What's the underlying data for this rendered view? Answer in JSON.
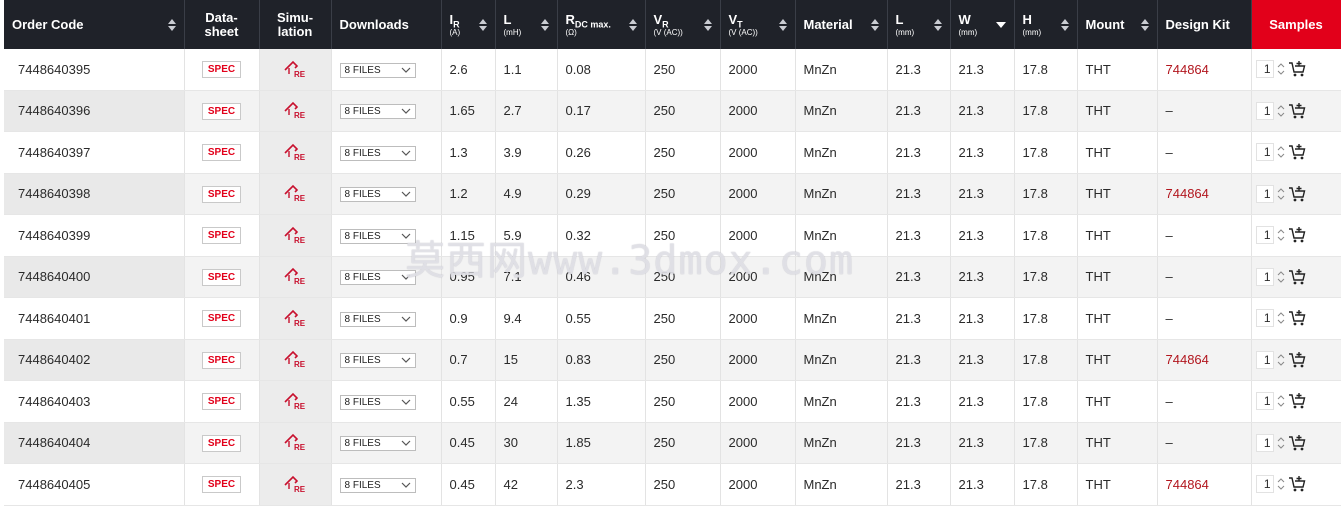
{
  "headers": {
    "order_code": "Order Code",
    "datasheet_1": "Data-",
    "datasheet_2": "sheet",
    "simulation_1": "Simu-",
    "simulation_2": "lation",
    "downloads": "Downloads",
    "ir": "I",
    "ir_sub": "R",
    "ir_unit": "(A)",
    "l": "L",
    "l_unit": "(mH)",
    "rdc": "R",
    "rdc_sub": "DC max.",
    "rdc_unit": "(Ω)",
    "vr": "V",
    "vr_sub": "R",
    "vr_unit": "(V (AC))",
    "vt": "V",
    "vt_sub": "T",
    "vt_unit": "(V (AC))",
    "material": "Material",
    "len": "L",
    "len_unit": "(mm)",
    "width": "W",
    "width_unit": "(mm)",
    "height": "H",
    "height_unit": "(mm)",
    "mount": "Mount",
    "design_kit": "Design Kit",
    "samples": "Samples"
  },
  "spec_label": "SPEC",
  "sim_icon_text": "RE",
  "rows": [
    {
      "code": "7448640395",
      "files": "8 FILES",
      "ir": "2.6",
      "l": "1.1",
      "rdc": "0.08",
      "vr": "250",
      "vt": "2000",
      "material": "MnZn",
      "len": "21.3",
      "w": "21.3",
      "h": "17.8",
      "mount": "THT",
      "kit": "744864",
      "qty": "1"
    },
    {
      "code": "7448640396",
      "files": "8 FILES",
      "ir": "1.65",
      "l": "2.7",
      "rdc": "0.17",
      "vr": "250",
      "vt": "2000",
      "material": "MnZn",
      "len": "21.3",
      "w": "21.3",
      "h": "17.8",
      "mount": "THT",
      "kit": "–",
      "qty": "1"
    },
    {
      "code": "7448640397",
      "files": "8 FILES",
      "ir": "1.3",
      "l": "3.9",
      "rdc": "0.26",
      "vr": "250",
      "vt": "2000",
      "material": "MnZn",
      "len": "21.3",
      "w": "21.3",
      "h": "17.8",
      "mount": "THT",
      "kit": "–",
      "qty": "1"
    },
    {
      "code": "7448640398",
      "files": "8 FILES",
      "ir": "1.2",
      "l": "4.9",
      "rdc": "0.29",
      "vr": "250",
      "vt": "2000",
      "material": "MnZn",
      "len": "21.3",
      "w": "21.3",
      "h": "17.8",
      "mount": "THT",
      "kit": "744864",
      "qty": "1"
    },
    {
      "code": "7448640399",
      "files": "8 FILES",
      "ir": "1.15",
      "l": "5.9",
      "rdc": "0.32",
      "vr": "250",
      "vt": "2000",
      "material": "MnZn",
      "len": "21.3",
      "w": "21.3",
      "h": "17.8",
      "mount": "THT",
      "kit": "–",
      "qty": "1"
    },
    {
      "code": "7448640400",
      "files": "8 FILES",
      "ir": "0.95",
      "l": "7.1",
      "rdc": "0.46",
      "vr": "250",
      "vt": "2000",
      "material": "MnZn",
      "len": "21.3",
      "w": "21.3",
      "h": "17.8",
      "mount": "THT",
      "kit": "–",
      "qty": "1"
    },
    {
      "code": "7448640401",
      "files": "8 FILES",
      "ir": "0.9",
      "l": "9.4",
      "rdc": "0.55",
      "vr": "250",
      "vt": "2000",
      "material": "MnZn",
      "len": "21.3",
      "w": "21.3",
      "h": "17.8",
      "mount": "THT",
      "kit": "–",
      "qty": "1"
    },
    {
      "code": "7448640402",
      "files": "8 FILES",
      "ir": "0.7",
      "l": "15",
      "rdc": "0.83",
      "vr": "250",
      "vt": "2000",
      "material": "MnZn",
      "len": "21.3",
      "w": "21.3",
      "h": "17.8",
      "mount": "THT",
      "kit": "744864",
      "qty": "1"
    },
    {
      "code": "7448640403",
      "files": "8 FILES",
      "ir": "0.55",
      "l": "24",
      "rdc": "1.35",
      "vr": "250",
      "vt": "2000",
      "material": "MnZn",
      "len": "21.3",
      "w": "21.3",
      "h": "17.8",
      "mount": "THT",
      "kit": "–",
      "qty": "1"
    },
    {
      "code": "7448640404",
      "files": "8 FILES",
      "ir": "0.45",
      "l": "30",
      "rdc": "1.85",
      "vr": "250",
      "vt": "2000",
      "material": "MnZn",
      "len": "21.3",
      "w": "21.3",
      "h": "17.8",
      "mount": "THT",
      "kit": "–",
      "qty": "1"
    },
    {
      "code": "7448640405",
      "files": "8 FILES",
      "ir": "0.45",
      "l": "42",
      "rdc": "2.3",
      "vr": "250",
      "vt": "2000",
      "material": "MnZn",
      "len": "21.3",
      "w": "21.3",
      "h": "17.8",
      "mount": "THT",
      "kit": "744864",
      "qty": "1"
    }
  ],
  "watermark": "莫西网www.3dmox.com",
  "colors": {
    "header_bg": "#1f2229",
    "samples_bg": "#e2001a",
    "kit_link": "#b2161e",
    "spec_text": "#e2001a"
  }
}
